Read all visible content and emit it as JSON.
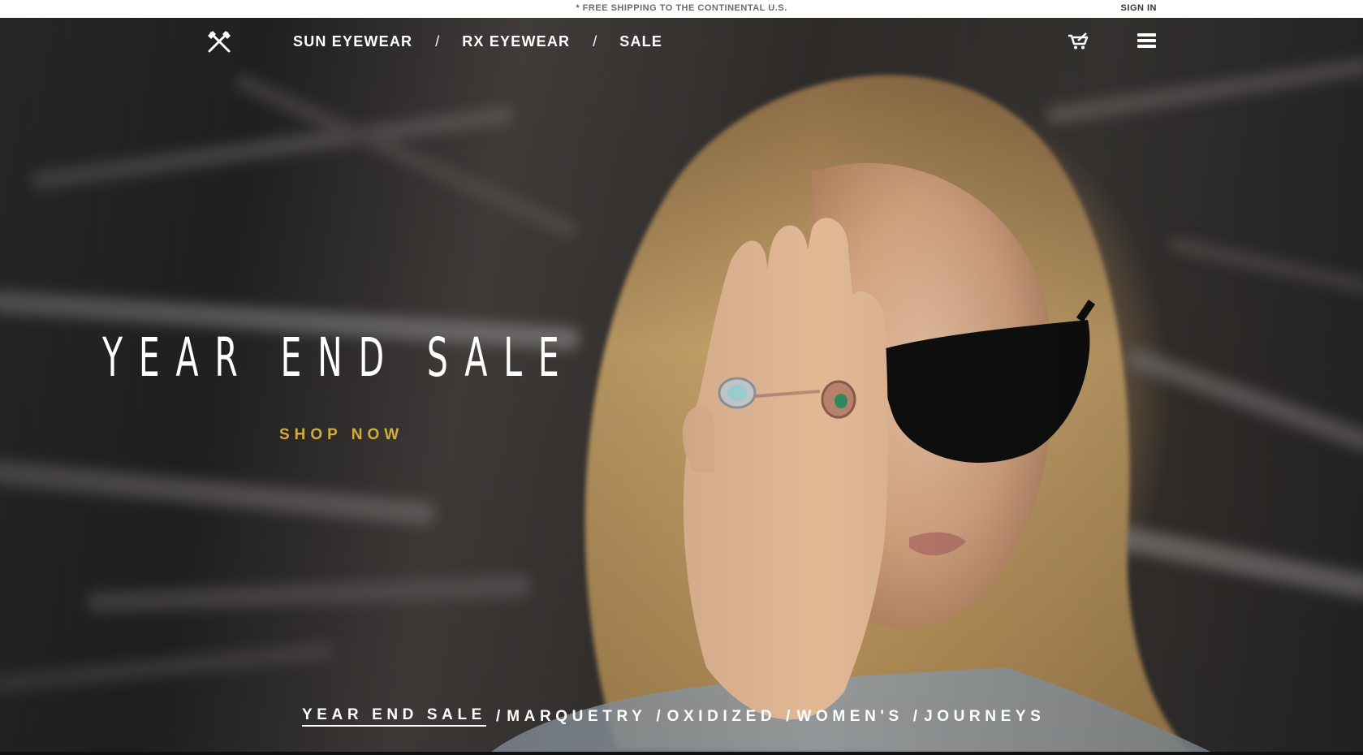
{
  "topbar": {
    "announcement": "* FREE SHIPPING TO THE CONTINENTAL U.S.",
    "sign_in": "SIGN IN"
  },
  "nav": {
    "logo_icon": "crossed-axes-icon",
    "links": [
      {
        "label": "SUN EYEWEAR"
      },
      {
        "label": "RX EYEWEAR"
      },
      {
        "label": "SALE"
      }
    ],
    "separator": "/",
    "cart_icon": "cart-icon",
    "menu_icon": "hamburger-menu-icon"
  },
  "hero": {
    "title": "YEAR END SALE",
    "cta": "SHOP NOW",
    "image_subject": "woman-covering-eye-wearing-black-sunglasses"
  },
  "collections": {
    "items": [
      {
        "label": "YEAR END SALE",
        "active": true
      },
      {
        "label": "MARQUETRY",
        "active": false
      },
      {
        "label": "OXIDIZED",
        "active": false
      },
      {
        "label": "WOMEN'S",
        "active": false
      },
      {
        "label": "JOURNEYS",
        "active": false
      }
    ],
    "separator": "/"
  },
  "colors": {
    "cta": "#d3ad3b",
    "nav_text": "#ffffff",
    "topbar_bg": "#ffffff"
  }
}
